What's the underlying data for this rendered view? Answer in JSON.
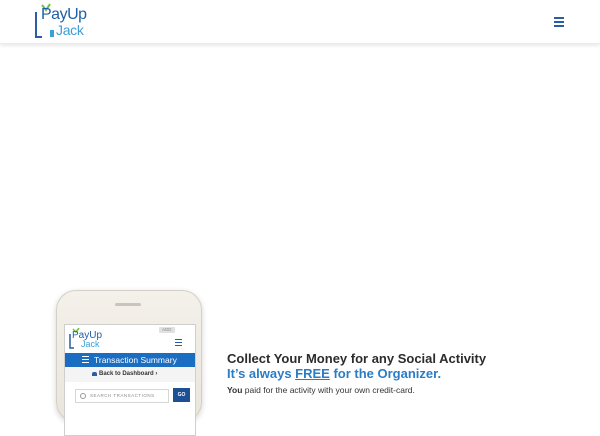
{
  "header": {
    "logo": {
      "line1": "PayUp",
      "line2": "Jack"
    }
  },
  "phone": {
    "logo": {
      "line1": "PayUp",
      "line2": "Jack"
    },
    "badge": "ADD",
    "bar_title": "Transaction Summary",
    "back_link": "Back to Dashboard ›",
    "search_placeholder": "SEARCH TRANSACTIONS",
    "go_label": "GO"
  },
  "content": {
    "headline": "Collect Your Money for any Social Activity",
    "subline_pre": "It’s always ",
    "subline_em": "FREE",
    "subline_post": " for the Organizer.",
    "body_bold": "You",
    "body_rest": " paid for the activity with your own credit-card."
  },
  "colors": {
    "brand_blue": "#1f5fa6",
    "accent_blue": "#2a7cc7",
    "bar_blue": "#1b6dc1"
  }
}
